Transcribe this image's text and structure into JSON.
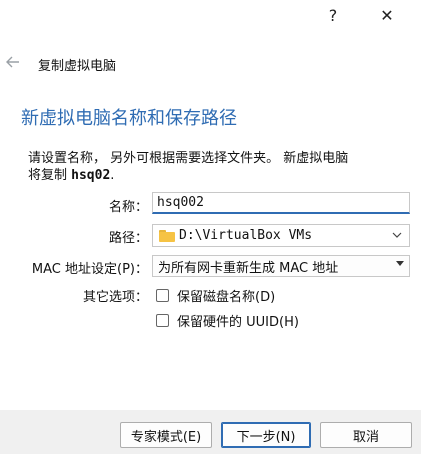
{
  "titlebar": {
    "help": "?",
    "close": "✕"
  },
  "dialog_title": "复制虚拟电脑",
  "page_title": "新虚拟电脑名称和保存路径",
  "description": {
    "line1": "请设置名称， 另外可根据需要选择文件夹。 新虚拟电脑",
    "line2_prefix": "将复制 ",
    "vm_name": "hsq02",
    "line2_suffix": "."
  },
  "form": {
    "name_label": "名称：",
    "name_value": "hsq002",
    "path_label": "路径：",
    "path_value": "D:\\VirtualBox VMs",
    "mac_label": "MAC 地址设定(P)：",
    "mac_value": "为所有网卡重新生成 MAC 地址",
    "other_label": "其它选项：",
    "keep_disk_names": "保留磁盘名称(D)",
    "keep_hw_uuids": "保留硬件的 UUID(H)"
  },
  "buttons": {
    "expert": "专家模式(E)",
    "next": "下一步(N)",
    "cancel": "取消"
  }
}
